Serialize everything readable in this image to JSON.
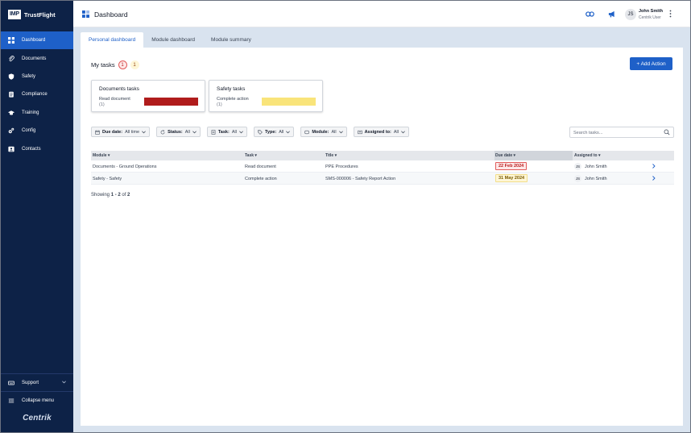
{
  "app": {
    "logo_box": "IMP",
    "logo_text": "TrustFlight",
    "brand_footer": "Centrik"
  },
  "colors": {
    "sidebar_bg": "#0d2247",
    "accent": "#1e60c8",
    "overdue": "#b01c1c",
    "due_soon": "#f9e47a"
  },
  "sidebar": {
    "items": [
      {
        "label": "Dashboard",
        "icon": "dashboard-icon",
        "active": true
      },
      {
        "label": "Documents",
        "icon": "paperclip-icon"
      },
      {
        "label": "Safety",
        "icon": "shield-icon"
      },
      {
        "label": "Compliance",
        "icon": "clipboard-icon"
      },
      {
        "label": "Training",
        "icon": "graduation-cap-icon"
      },
      {
        "label": "Config",
        "icon": "gears-icon"
      },
      {
        "label": "Contacts",
        "icon": "contact-card-icon"
      }
    ],
    "support_label": "Support",
    "collapse_label": "Collapse menu"
  },
  "header": {
    "title": "Dashboard",
    "user": {
      "initials": "JS",
      "name": "John Smith",
      "role": "Centrik User"
    }
  },
  "tabs": [
    {
      "label": "Personal dashboard",
      "active": true
    },
    {
      "label": "Module dashboard"
    },
    {
      "label": "Module summary"
    }
  ],
  "my_tasks": {
    "title": "My tasks",
    "overdue_count": "1",
    "due_count": "1",
    "add_action_label": "+ Add Action",
    "cards": [
      {
        "title": "Documents tasks",
        "label": "Read document",
        "count": "(1)",
        "bar_color": "#b01c1c"
      },
      {
        "title": "Safety tasks",
        "label": "Complete action",
        "count": "(1)",
        "bar_color": "#f9e47a"
      }
    ]
  },
  "filters": [
    {
      "label": "Due date:",
      "value": "All time",
      "icon": "calendar-icon"
    },
    {
      "label": "Status:",
      "value": "All",
      "icon": "refresh-icon"
    },
    {
      "label": "Task:",
      "value": "All",
      "icon": "task-icon"
    },
    {
      "label": "Type:",
      "value": "All",
      "icon": "tag-icon"
    },
    {
      "label": "Module:",
      "value": "All",
      "icon": "module-icon"
    },
    {
      "label": "Assigned to:",
      "value": "All",
      "icon": "users-icon"
    }
  ],
  "search": {
    "placeholder": "Search tasks..."
  },
  "table": {
    "columns": [
      "Module",
      "Task",
      "Title",
      "Due date",
      "Assigned to"
    ],
    "rows": [
      {
        "module": "Documents - Ground Operations",
        "task": "Read document",
        "title": "PPE Procedures",
        "due": "22 Feb 2024",
        "due_status": "overdue",
        "assignee_initials": "JS",
        "assignee": "John Smith"
      },
      {
        "module": "Safety - Safety",
        "task": "Complete action",
        "title": "SMS-000006 - Safety Report Action",
        "due": "31 May 2024",
        "due_status": "due",
        "assignee_initials": "JS",
        "assignee": "John Smith"
      }
    ],
    "showing": {
      "prefix": "Showing ",
      "range": "1 - 2",
      "of": " of ",
      "total": "2"
    }
  }
}
